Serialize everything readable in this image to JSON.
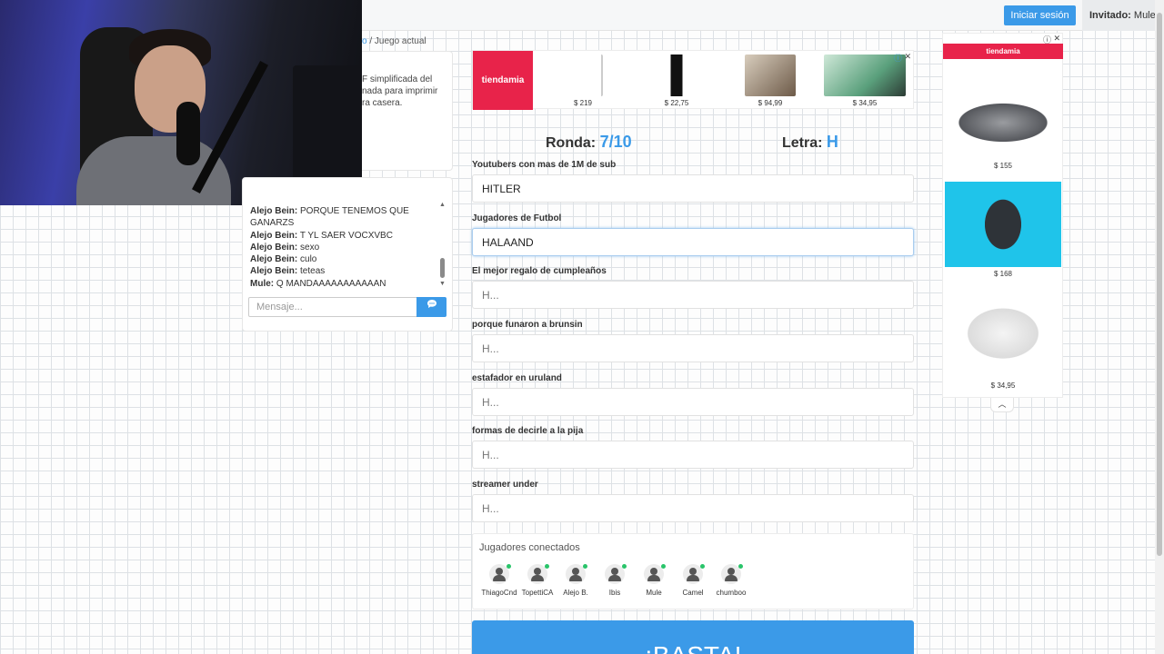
{
  "header": {
    "login_label": "Iniciar sesión",
    "guest_label": "Invitado:",
    "guest_name": "Mule"
  },
  "breadcrumb": {
    "link_fragment": "o",
    "separator": "/",
    "current": "Juego actual"
  },
  "left_card": {
    "lines": [
      "F simplificada del",
      "nada para imprimir",
      "ra casera."
    ]
  },
  "chat": {
    "messages": [
      {
        "user": "Alejo Bein:",
        "text": "PORQUE TENEMOS QUE GANARZS"
      },
      {
        "user": "Alejo Bein:",
        "text": "T YL SAER VOCXVBC"
      },
      {
        "user": "Alejo Bein:",
        "text": "sexo"
      },
      {
        "user": "Alejo Bein:",
        "text": "culo"
      },
      {
        "user": "Alejo Bein:",
        "text": "teteas"
      },
      {
        "user": "Mule:",
        "text": "Q MANDAAAAAAAAAAAN"
      }
    ],
    "input_placeholder": "Mensaje...",
    "send_icon": "chat-bubble-icon"
  },
  "ad_banner": {
    "brand": "tiendamia",
    "items": [
      {
        "price": "$ 219",
        "color": "#ffffff"
      },
      {
        "price": "$ 22,75",
        "color": "#f2f2f2"
      },
      {
        "price": "$ 94,99",
        "color": "#7a6a5a"
      },
      {
        "price": "$ 34,95",
        "color": "#5aa07c"
      }
    ]
  },
  "game": {
    "round_label": "Ronda:",
    "round_value": "7/10",
    "letter_label": "Letra:",
    "letter_value": "H",
    "categories": [
      {
        "label": "Youtubers con mas de 1M de sub",
        "value": "HITLER",
        "placeholder": "H..."
      },
      {
        "label": "Jugadores de Futbol",
        "value": "HALAAND",
        "placeholder": "H..."
      },
      {
        "label": "El mejor regalo de cumpleaños",
        "value": "",
        "placeholder": "H..."
      },
      {
        "label": "porque funaron a brunsin",
        "value": "",
        "placeholder": "H..."
      },
      {
        "label": "estafador en uruland",
        "value": "",
        "placeholder": "H..."
      },
      {
        "label": "formas de decirle a la pija",
        "value": "",
        "placeholder": "H..."
      },
      {
        "label": "streamer under",
        "value": "",
        "placeholder": "H..."
      }
    ]
  },
  "players": {
    "title": "Jugadores conectados",
    "list": [
      "ThiagoCnd",
      "TopettiCA",
      "Alejo B.",
      "Ibis",
      "Mule",
      "Camel",
      "chumboo"
    ]
  },
  "basta_label": "¡BASTA!",
  "side_ad": {
    "brand": "tiendamia",
    "items": [
      {
        "price": "$ 155"
      },
      {
        "price": "$ 168"
      },
      {
        "price": "$ 34,95"
      }
    ]
  },
  "colors": {
    "accent": "#3b9ae8",
    "brand_ad": "#e8234a",
    "online": "#29c46a"
  }
}
